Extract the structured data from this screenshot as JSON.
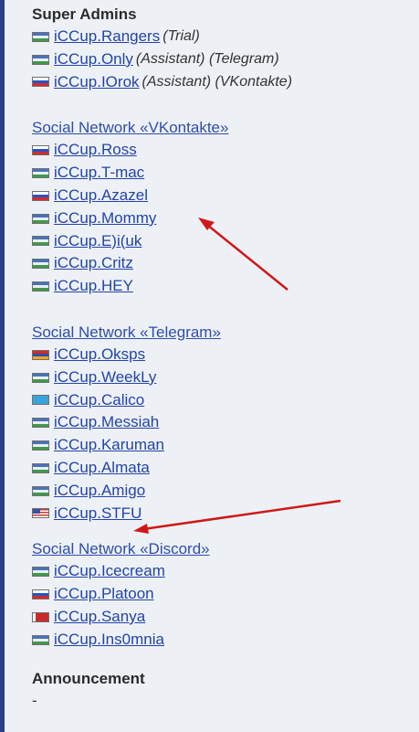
{
  "super_admins": {
    "title": "Super Admins",
    "members": [
      {
        "name": "iCCup.Rangers",
        "note": "(Trial)",
        "flag": "kz"
      },
      {
        "name": "iCCup.Only",
        "note": "(Assistant) (Telegram)",
        "flag": "kz"
      },
      {
        "name": "iCCup.IOrok",
        "note": "(Assistant) (VKontakte)",
        "flag": "ru"
      }
    ]
  },
  "vk": {
    "title": "Social Network «VKontakte»",
    "members": [
      {
        "name": "iCCup.Ross",
        "flag": "ru"
      },
      {
        "name": "iCCup.T-mac ",
        "flag": "kz"
      },
      {
        "name": "iCCup.Azazel",
        "flag": "ru"
      },
      {
        "name": "iCCup.Mommy",
        "flag": "kz"
      },
      {
        "name": "iCCup.E)i(uk",
        "flag": "kz"
      },
      {
        "name": "iCCup.Critz",
        "flag": "kz"
      },
      {
        "name": "iCCup.HEY",
        "flag": "kz"
      }
    ]
  },
  "telegram": {
    "title": "Social Network «Telegram»",
    "members": [
      {
        "name": "iCCup.Oksps",
        "flag": "am"
      },
      {
        "name": "iCCup.WeekLy",
        "flag": "kz"
      },
      {
        "name": "iCCup.Calico",
        "flag": "kzb"
      },
      {
        "name": "iCCup.Messiah ",
        "flag": "kz"
      },
      {
        "name": "iCCup.Karuman",
        "flag": "kz"
      },
      {
        "name": "iCCup.Almata",
        "flag": "kz"
      },
      {
        "name": "iCCup.Amigo",
        "flag": "kz"
      },
      {
        "name": "iCCup.STFU",
        "flag": "us"
      }
    ]
  },
  "discord": {
    "title": "Social Network «Discord»",
    "members": [
      {
        "name": "iCCup.Icecream",
        "flag": "kz"
      },
      {
        "name": "iCCup.Platoon",
        "flag": "ru"
      },
      {
        "name": "iCCup.Sanya",
        "flag": "by"
      },
      {
        "name": "iCCup.Ins0mnia",
        "flag": "kz"
      }
    ]
  },
  "announcement": {
    "title": "Announcement",
    "text": "-"
  },
  "colors": {
    "link": "#2344a6",
    "panel_bg": "#edf1f6",
    "border": "#2a3f8a",
    "arrow": "#d01818"
  }
}
